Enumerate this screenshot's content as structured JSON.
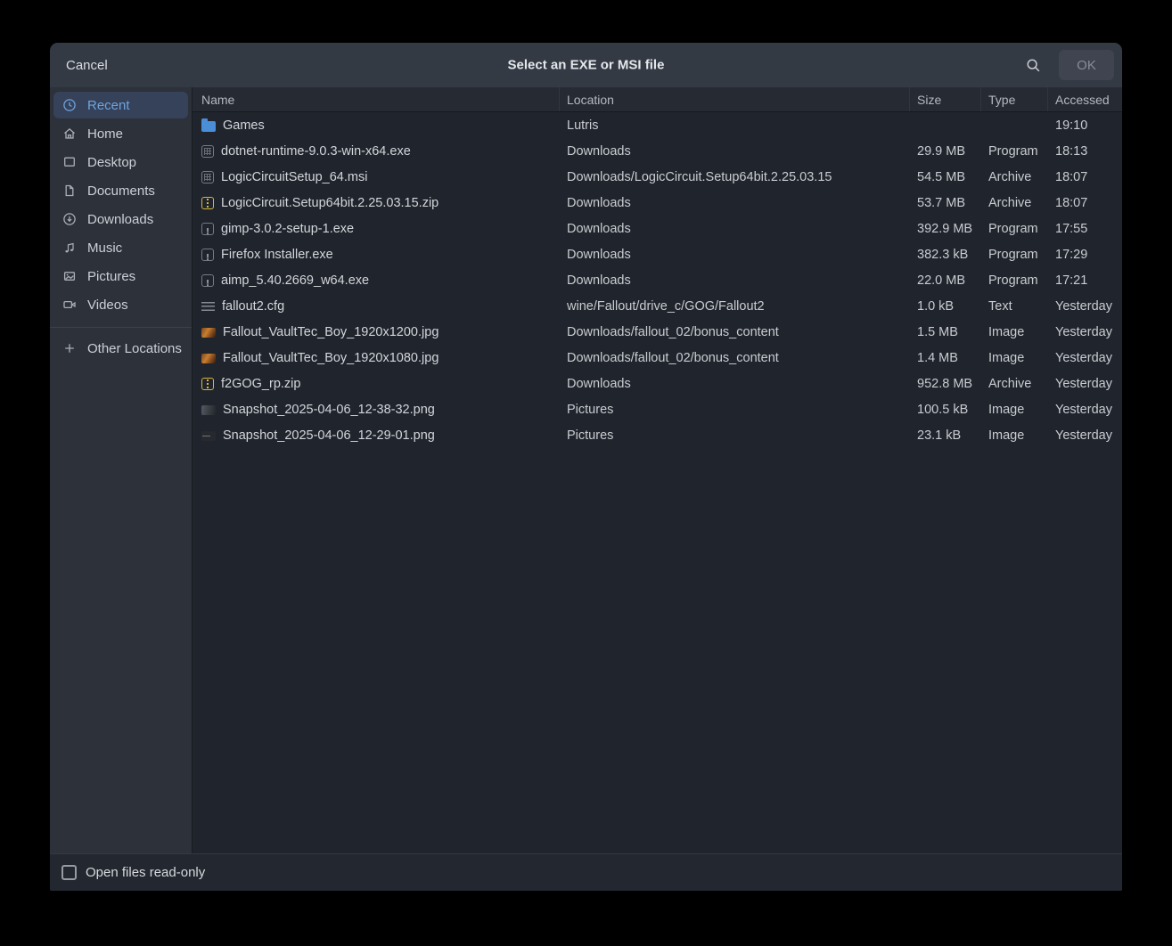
{
  "window": {
    "title": "Select an EXE or MSI file",
    "cancel_label": "Cancel",
    "ok_label": "OK",
    "ok_enabled": false,
    "search_icon": "search-icon"
  },
  "sidebar": {
    "items": [
      {
        "label": "Recent",
        "icon": "clock-icon",
        "selected": true
      },
      {
        "label": "Home",
        "icon": "home-icon",
        "selected": false
      },
      {
        "label": "Desktop",
        "icon": "desktop-icon",
        "selected": false
      },
      {
        "label": "Documents",
        "icon": "document-icon",
        "selected": false
      },
      {
        "label": "Downloads",
        "icon": "download-icon",
        "selected": false
      },
      {
        "label": "Music",
        "icon": "music-note-icon",
        "selected": false
      },
      {
        "label": "Pictures",
        "icon": "picture-icon",
        "selected": false
      },
      {
        "label": "Videos",
        "icon": "video-camera-icon",
        "selected": false
      },
      {
        "label": "Other Locations",
        "icon": "plus-icon",
        "selected": false
      }
    ]
  },
  "table": {
    "columns": [
      "Name",
      "Location",
      "Size",
      "Type",
      "Accessed"
    ],
    "rows": [
      {
        "icon": "folder-icon",
        "name": "Games",
        "location": "Lutris",
        "size": "",
        "type": "",
        "accessed": "19:10"
      },
      {
        "icon": "program-icon",
        "name": "dotnet-runtime-9.0.3-win-x64.exe",
        "location": "Downloads",
        "size": "29.9 MB",
        "type": "Program",
        "accessed": "18:13"
      },
      {
        "icon": "program-icon",
        "name": "LogicCircuitSetup_64.msi",
        "location": "Downloads/LogicCircuit.Setup64bit.2.25.03.15",
        "size": "54.5 MB",
        "type": "Archive",
        "accessed": "18:07"
      },
      {
        "icon": "archive-icon",
        "name": "LogicCircuit.Setup64bit.2.25.03.15.zip",
        "location": "Downloads",
        "size": "53.7 MB",
        "type": "Archive",
        "accessed": "18:07"
      },
      {
        "icon": "installer-icon",
        "name": "gimp-3.0.2-setup-1.exe",
        "location": "Downloads",
        "size": "392.9 MB",
        "type": "Program",
        "accessed": "17:55"
      },
      {
        "icon": "installer-icon",
        "name": "Firefox Installer.exe",
        "location": "Downloads",
        "size": "382.3 kB",
        "type": "Program",
        "accessed": "17:29"
      },
      {
        "icon": "installer-icon",
        "name": "aimp_5.40.2669_w64.exe",
        "location": "Downloads",
        "size": "22.0 MB",
        "type": "Program",
        "accessed": "17:21"
      },
      {
        "icon": "text-icon",
        "name": "fallout2.cfg",
        "location": "wine/Fallout/drive_c/GOG/Fallout2",
        "size": "1.0 kB",
        "type": "Text",
        "accessed": "Yesterday"
      },
      {
        "icon": "image-fallout-icon",
        "name": "Fallout_VaultTec_Boy_1920x1200.jpg",
        "location": "Downloads/fallout_02/bonus_content",
        "size": "1.5 MB",
        "type": "Image",
        "accessed": "Yesterday"
      },
      {
        "icon": "image-fallout-icon",
        "name": "Fallout_VaultTec_Boy_1920x1080.jpg",
        "location": "Downloads/fallout_02/bonus_content",
        "size": "1.4 MB",
        "type": "Image",
        "accessed": "Yesterday"
      },
      {
        "icon": "archive-icon",
        "name": "f2GOG_rp.zip",
        "location": "Downloads",
        "size": "952.8 MB",
        "type": "Archive",
        "accessed": "Yesterday"
      },
      {
        "icon": "image-snapshot-icon",
        "name": "Snapshot_2025-04-06_12-38-32.png",
        "location": "Pictures",
        "size": "100.5 kB",
        "type": "Image",
        "accessed": "Yesterday"
      },
      {
        "icon": "image-snapshot-dark-icon",
        "name": "Snapshot_2025-04-06_12-29-01.png",
        "location": "Pictures",
        "size": "23.1 kB",
        "type": "Image",
        "accessed": "Yesterday"
      }
    ]
  },
  "footer": {
    "checkbox_label": "Open files read-only",
    "checkbox_checked": false
  },
  "colors": {
    "accent": "#6fa3dc",
    "selected_item_bg": "#36425a",
    "folder": "#4a8ed8",
    "archive": "#d9b63e",
    "headerbar_bg": "#343a44",
    "sidebar_bg": "#2c313a",
    "list_bg": "#20242c"
  }
}
